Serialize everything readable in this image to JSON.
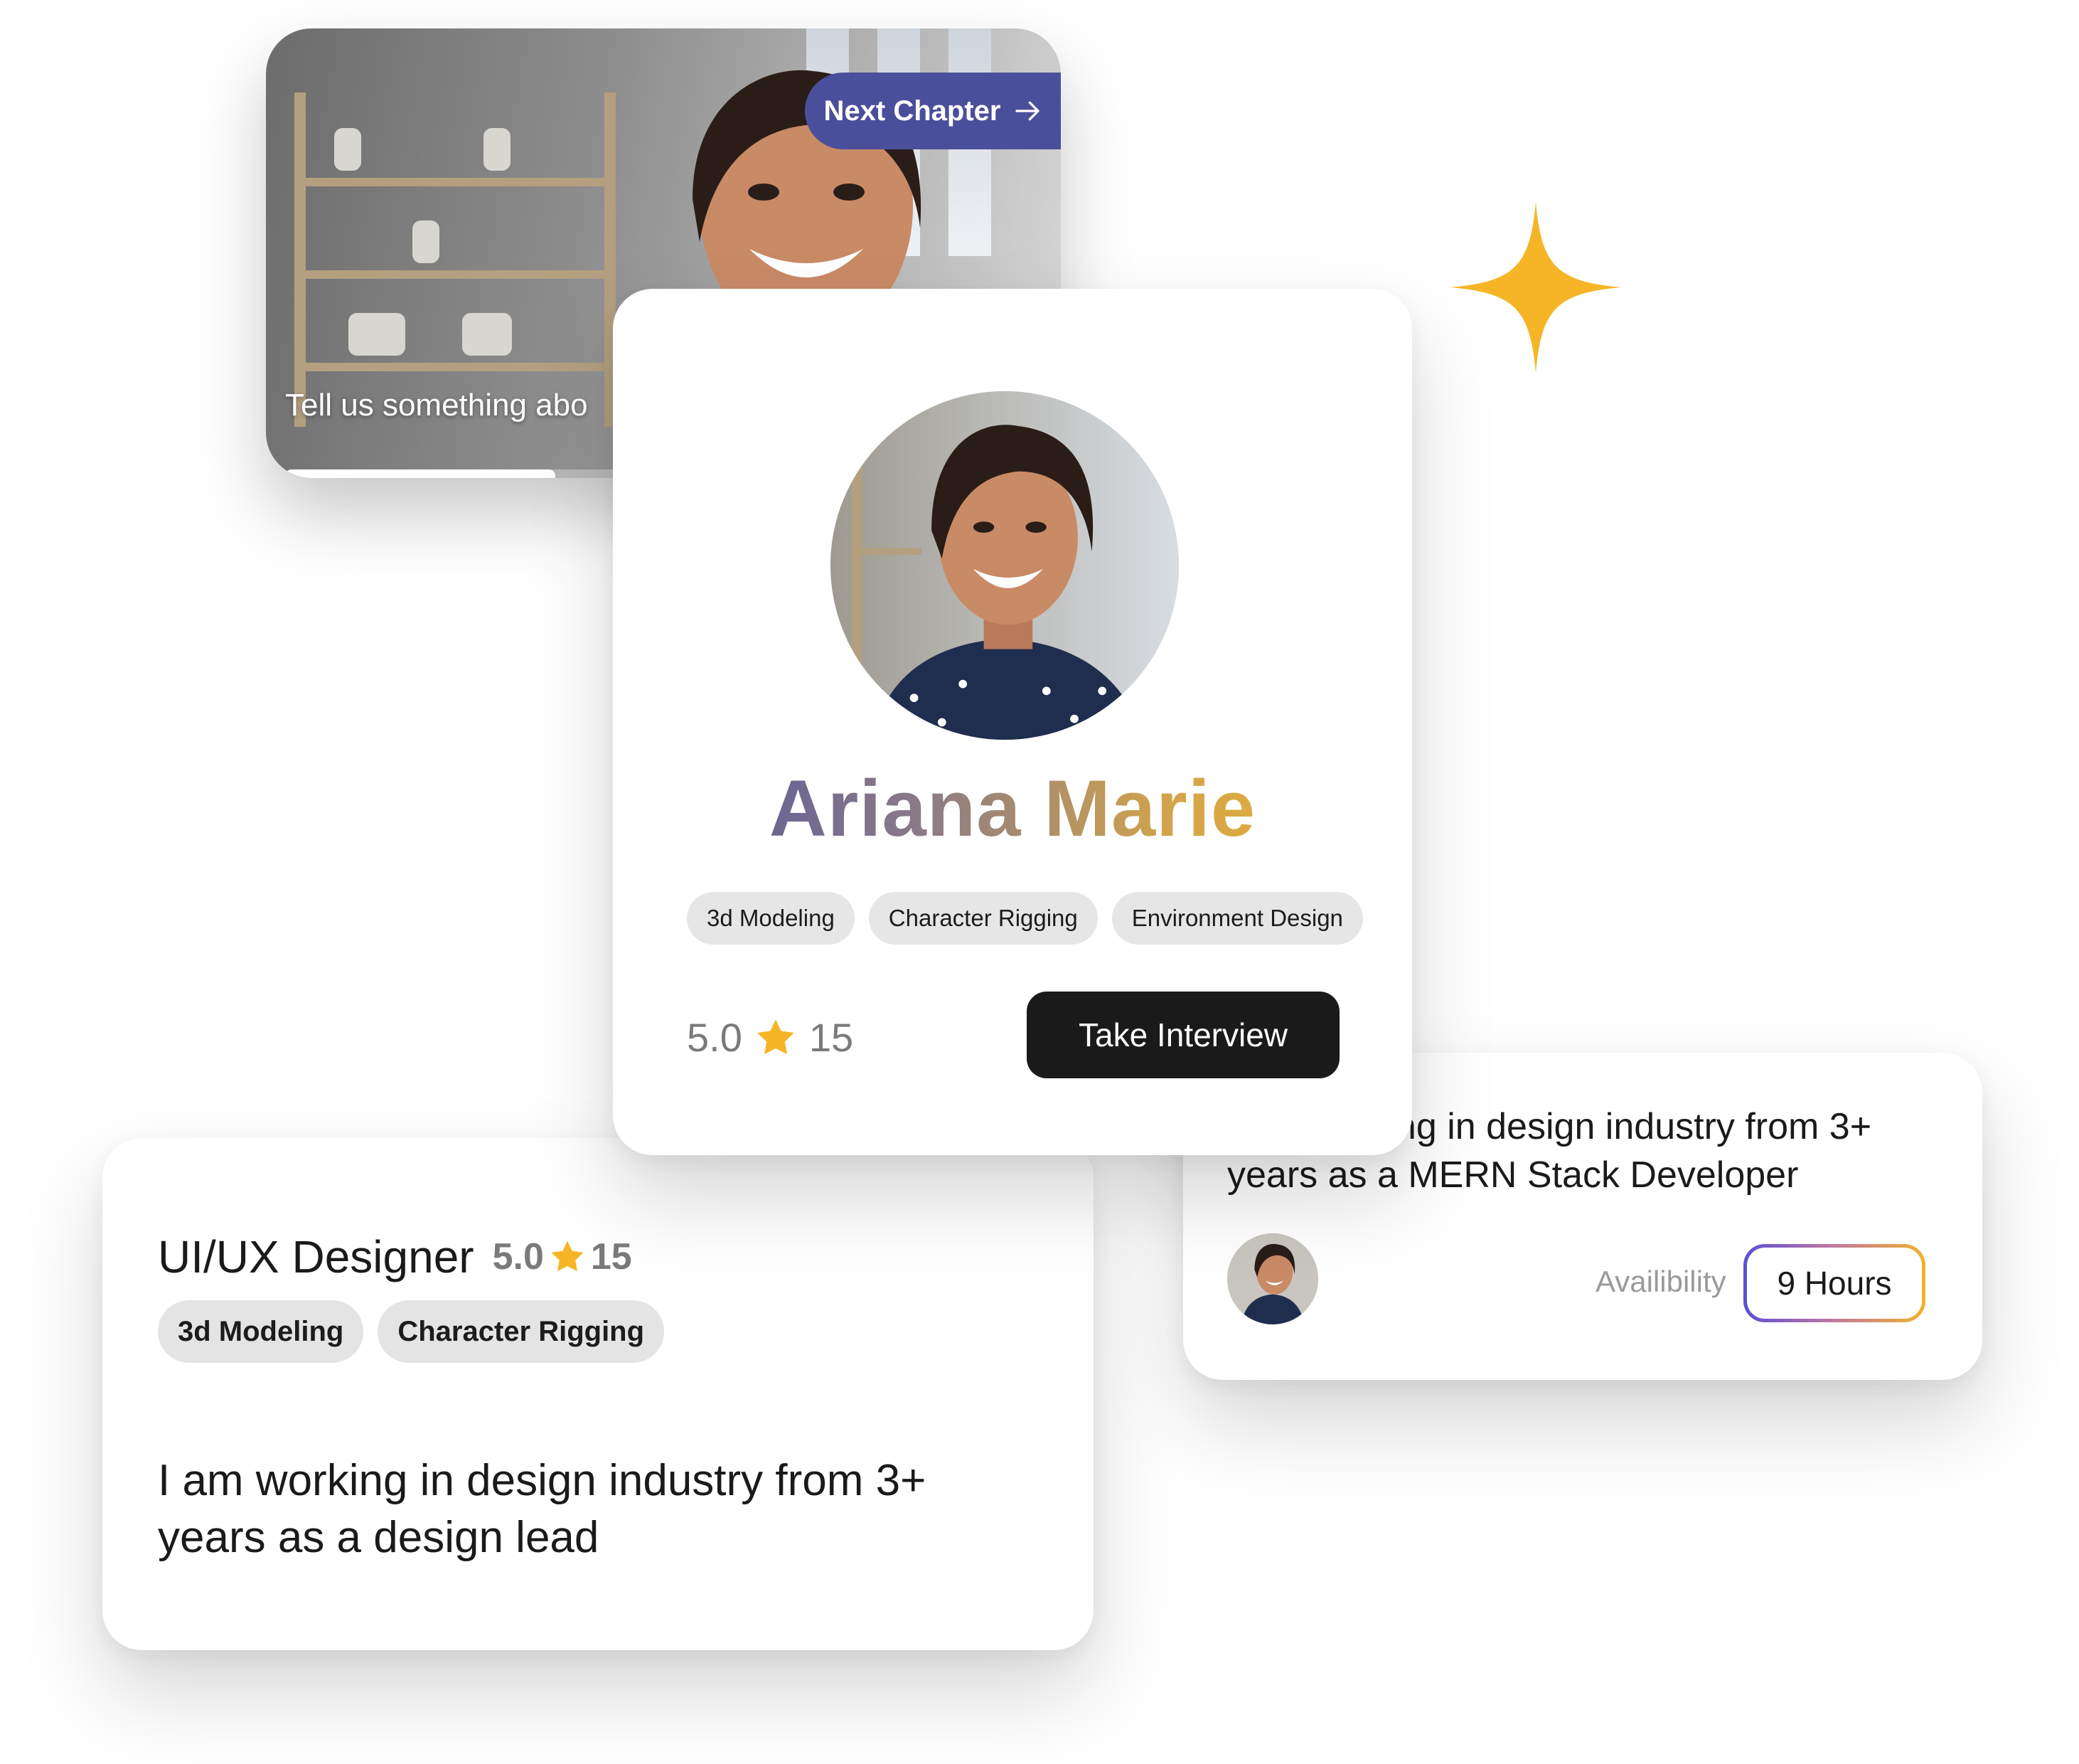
{
  "video_card": {
    "next_chapter_label": "Next Chapter",
    "caption": "Tell us something abo",
    "progress": 0.38
  },
  "profile_card": {
    "name": "Ariana Marie",
    "tags": [
      "3d Modeling",
      "Character Rigging",
      "Environment Design"
    ],
    "rating": "5.0",
    "reviews": "15",
    "button_label": "Take Interview"
  },
  "designer_card": {
    "title": "UI/UX Designer",
    "rating": "5.0",
    "reviews": "15",
    "tags": [
      "3d Modeling",
      "Character Rigging"
    ],
    "description": "I am working in design industry from 3+ years as a design lead"
  },
  "developer_card": {
    "description": "I am working in design industry from 3+ years as a MERN Stack Developer",
    "availability_label": "Availibility",
    "hours": "9 Hours"
  },
  "colors": {
    "accent_purple": "#4a4f9c",
    "accent_gold": "#f0b62c",
    "star": "#f5b526"
  }
}
